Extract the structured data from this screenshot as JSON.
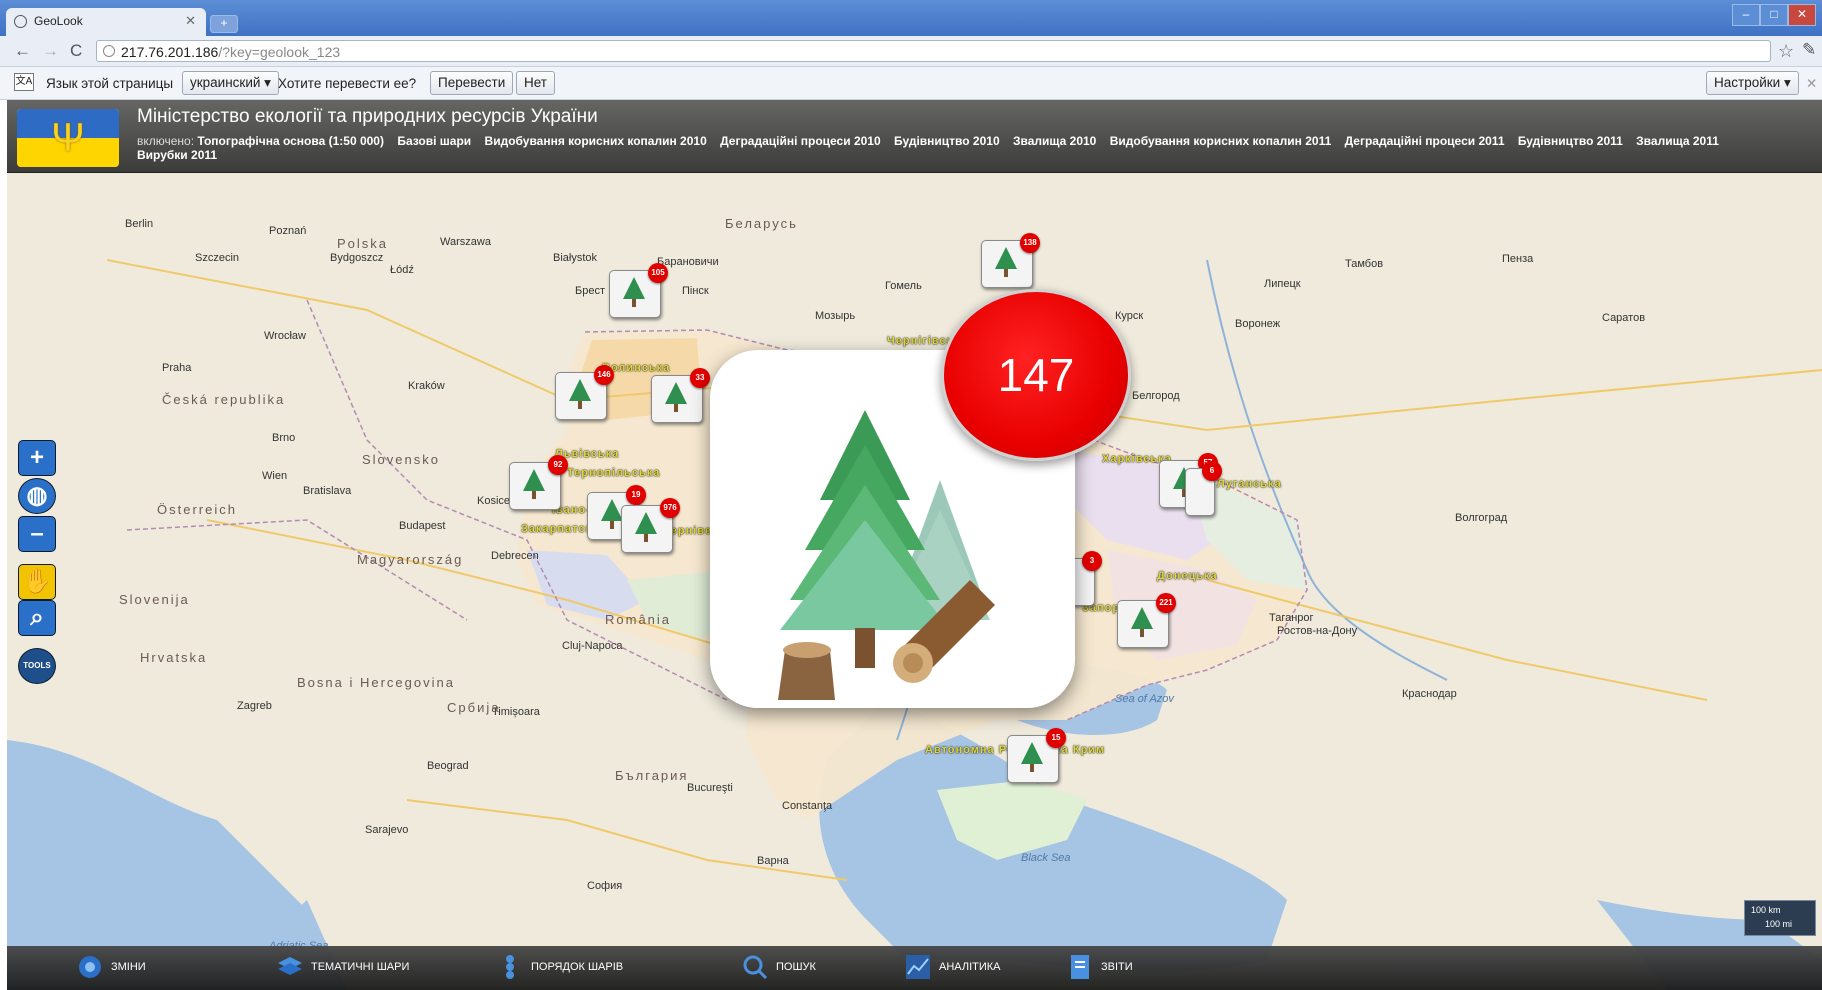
{
  "browser": {
    "tab_title": "GeoLook",
    "url_host": "217.76.201.186",
    "url_path": "/?key=geolook_123",
    "window_controls": [
      "–",
      "□",
      "✕"
    ]
  },
  "translate_bar": {
    "prompt": "Язык этой страницы",
    "language": "украинский ▾",
    "question": "Хотите перевести ее?",
    "translate": "Перевести",
    "no": "Нет",
    "settings": "Настройки ▾"
  },
  "header": {
    "title": "Міністерство екології та природних ресурсів України",
    "layers_label": "включено:",
    "layers": [
      "Топографічна основа (1:50 000)",
      "Базові шари",
      "Видобування корисних копалин 2010",
      "Деградаційні процеси 2010",
      "Будівництво 2010",
      "Звалища 2010",
      "Видобування корисних копалин 2011",
      "Деградаційні процеси 2011",
      "Будівництво 2011",
      "Звалища 2011",
      "Вирубки 2011"
    ]
  },
  "map": {
    "countries": [
      "Беларусь",
      "Polska",
      "Česká republika",
      "Slovensko",
      "Österreich",
      "Magyarország",
      "România",
      "Slovenija",
      "Hrvatska",
      "Bosna i Hercegovina",
      "Србија",
      "България"
    ],
    "cities": [
      "Berlin",
      "Poznań",
      "Warszawa",
      "Łódź",
      "Kraków",
      "Wrocław",
      "Praha",
      "Brno",
      "Wien",
      "Bratislava",
      "Budapest",
      "Debrecen",
      "Cluj-Napoca",
      "Zagreb",
      "Beograd",
      "Bucureşti",
      "Constanţa",
      "София",
      "Варна",
      "Гомель",
      "Мозырь",
      "Пінск",
      "Брест",
      "Воронеж",
      "Курск",
      "Белгород",
      "Таганрог",
      "Ростов-на-Дону",
      "Волгоград",
      "Краснодар",
      "Саратов",
      "Szczecin",
      "Bydgoszcz",
      "Białystok",
      "Барановичи",
      "Липецк",
      "Пенза",
      "Тамбов",
      "Kosice",
      "Timișoara",
      "Sarajevo"
    ],
    "seas": [
      "Black Sea",
      "Sea of Azov",
      "Adriatic Sea"
    ],
    "regions": [
      "Волинська",
      "Чернігівська",
      "Львівська",
      "Тернопільська",
      "Івано-Франківська",
      "Закарпатська",
      "Чернівецька",
      "Харківська",
      "Луганська",
      "Донецька",
      "Запорізька",
      "Автономна Республіка Крим"
    ],
    "markers": [
      "105",
      "138",
      "146",
      "33",
      "92",
      "19",
      "976",
      "57",
      "6",
      "3",
      "221",
      "15"
    ],
    "popup_count": "147",
    "scale_km": "100 km",
    "scale_mi": "100 mi"
  },
  "tools": [
    "zoom-in",
    "globe",
    "zoom-out",
    "pan",
    "zoom-box",
    "tools"
  ],
  "tools_label": "TOOLS",
  "bottom_nav": [
    {
      "label": "ЗМІНИ"
    },
    {
      "label": "ТЕМАТИЧНІ ШАРИ"
    },
    {
      "label": "ПОРЯДОК ШАРІВ"
    },
    {
      "label": "ПОШУК"
    },
    {
      "label": "АНАЛІТИКА"
    },
    {
      "label": "ЗВІТИ"
    }
  ],
  "colors": {
    "badge": "#e00000",
    "header": "#3a3a3a",
    "region_label": "#e0d83a"
  }
}
